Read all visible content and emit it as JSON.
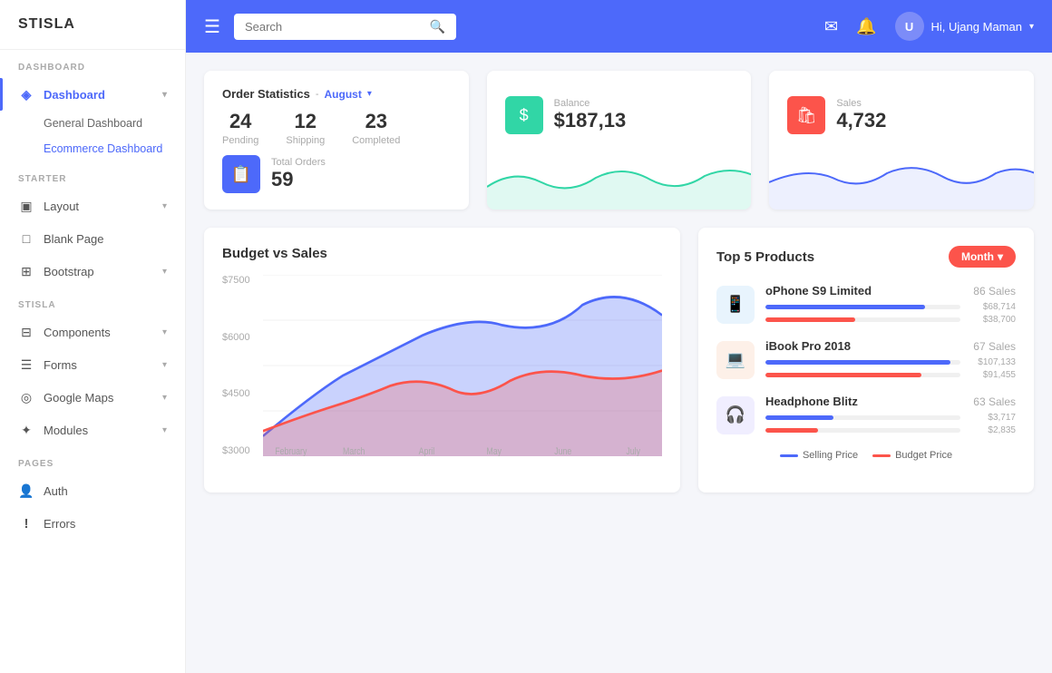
{
  "app": {
    "logo": "STISLA"
  },
  "sidebar": {
    "sections": [
      {
        "label": "DASHBOARD",
        "items": [
          {
            "id": "dashboard",
            "label": "Dashboard",
            "icon": "◈",
            "active": true,
            "hasArrow": true
          },
          {
            "id": "general-dashboard",
            "label": "General Dashboard",
            "icon": "",
            "sub": true,
            "active": false
          },
          {
            "id": "ecommerce-dashboard",
            "label": "Ecommerce Dashboard",
            "icon": "",
            "sub": true,
            "active": true
          }
        ]
      },
      {
        "label": "STARTER",
        "items": [
          {
            "id": "layout",
            "label": "Layout",
            "icon": "▣",
            "active": false,
            "hasArrow": true
          },
          {
            "id": "blank-page",
            "label": "Blank Page",
            "icon": "□",
            "active": false,
            "hasArrow": false
          },
          {
            "id": "bootstrap",
            "label": "Bootstrap",
            "icon": "⊞",
            "active": false,
            "hasArrow": true
          }
        ]
      },
      {
        "label": "STISLA",
        "items": [
          {
            "id": "components",
            "label": "Components",
            "icon": "⊟",
            "active": false,
            "hasArrow": true
          },
          {
            "id": "forms",
            "label": "Forms",
            "icon": "☰",
            "active": false,
            "hasArrow": true
          },
          {
            "id": "google-maps",
            "label": "Google Maps",
            "icon": "◎",
            "active": false,
            "hasArrow": true
          },
          {
            "id": "modules",
            "label": "Modules",
            "icon": "✦",
            "active": false,
            "hasArrow": true
          }
        ]
      },
      {
        "label": "PAGES",
        "items": [
          {
            "id": "auth",
            "label": "Auth",
            "icon": "👤",
            "active": false,
            "hasArrow": false
          },
          {
            "id": "errors",
            "label": "Errors",
            "icon": "!",
            "active": false,
            "hasArrow": false
          }
        ]
      }
    ]
  },
  "header": {
    "search_placeholder": "Search",
    "user_greeting": "Hi, Ujang Maman",
    "user_initial": "U"
  },
  "order_stats": {
    "title": "Order Statistics",
    "period": "August",
    "pending": {
      "value": "24",
      "label": "Pending"
    },
    "shipping": {
      "value": "12",
      "label": "Shipping"
    },
    "completed": {
      "value": "23",
      "label": "Completed"
    },
    "total_orders_label": "Total Orders",
    "total_orders_value": "59"
  },
  "balance_card": {
    "label": "Balance",
    "value": "$187,13"
  },
  "sales_card": {
    "label": "Sales",
    "value": "4,732"
  },
  "budget_chart": {
    "title": "Budget vs Sales",
    "y_labels": [
      "$7500",
      "$6000",
      "$4500",
      "$3000"
    ],
    "x_labels": [
      "February",
      "March",
      "April",
      "May",
      "June",
      "July"
    ]
  },
  "top_products": {
    "title": "Top 5 Products",
    "month_btn": "Month",
    "items": [
      {
        "name": "oPhone S9 Limited",
        "sales": "86 Sales",
        "icon": "📱",
        "icon_type": "sky",
        "selling_price_label": "$68,714",
        "budget_price_label": "$38,700",
        "selling_width": 82,
        "budget_width": 46
      },
      {
        "name": "iBook Pro 2018",
        "sales": "67 Sales",
        "icon": "💻",
        "icon_type": "peach",
        "selling_price_label": "$107,133",
        "budget_price_label": "$91,455",
        "selling_width": 95,
        "budget_width": 80
      },
      {
        "name": "Headphone Blitz",
        "sales": "63 Sales",
        "icon": "🎧",
        "icon_type": "lavender",
        "selling_price_label": "$3,717",
        "budget_price_label": "$2,835",
        "selling_width": 35,
        "budget_width": 27
      }
    ],
    "legend": {
      "selling": "Selling Price",
      "budget": "Budget Price"
    }
  }
}
